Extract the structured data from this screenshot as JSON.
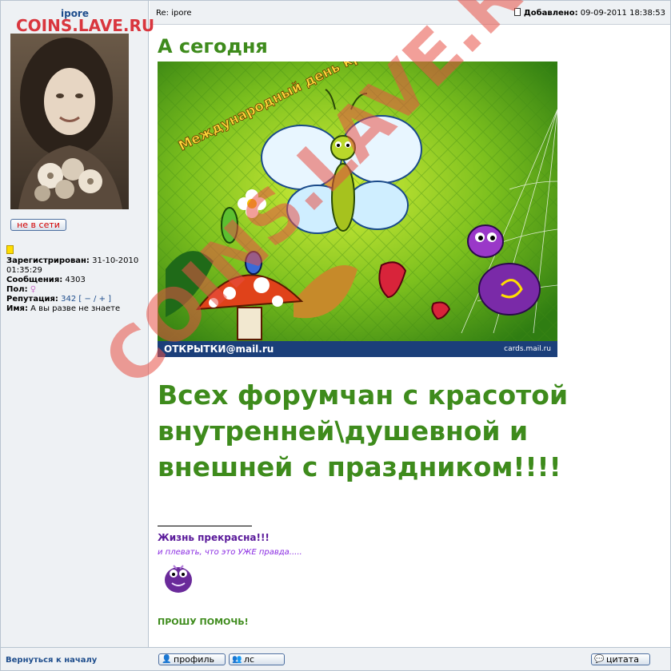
{
  "poster": {
    "username": "ipore",
    "status_button": "не в сети",
    "registered_label": "Зарегистрирован:",
    "registered_value": "31-10-2010",
    "registered_time": "01:35:29",
    "posts_label": "Сообщения:",
    "posts_value": "4303",
    "gender_label": "Пол:",
    "reputation_label": "Репутация:",
    "reputation_value": "342",
    "reputation_controls": "[ − / + ]",
    "name_label": "Имя:",
    "name_value": "А вы разве не знаете"
  },
  "post": {
    "subject": "Re: ipore",
    "added_label": "Добавлено:",
    "added_value": "09-09-2011 18:38:53",
    "title": "А сегодня",
    "card": {
      "brand": "ОТКРЫТКИ@mail.ru",
      "url": "cards.mail.ru",
      "banner": "Международный день красоты"
    },
    "greeting_lines": [
      "Всех форумчан с красотой",
      "внутренней\\душевной и",
      "внешней с праздником!!!!"
    ],
    "signature": {
      "title": "Жизнь прекрасна!!!",
      "subtitle": "и плевать, что это УЖЕ правда....."
    },
    "help_text": "ПРОШУ ПОМОЧЬ!"
  },
  "bottom": {
    "back_link": "Вернуться к началу",
    "profile_button": "профиль",
    "pm_button": "лс",
    "quote_button": "цитата"
  },
  "watermarks": {
    "top": "COINS.LAVE.RU",
    "diagonal": "COINS.LAVE.RU"
  },
  "colors": {
    "accent_green": "#3e8b1c",
    "link_blue": "#1e4d8c",
    "offline_red": "#d30000",
    "watermark_red": "#d9363e"
  }
}
